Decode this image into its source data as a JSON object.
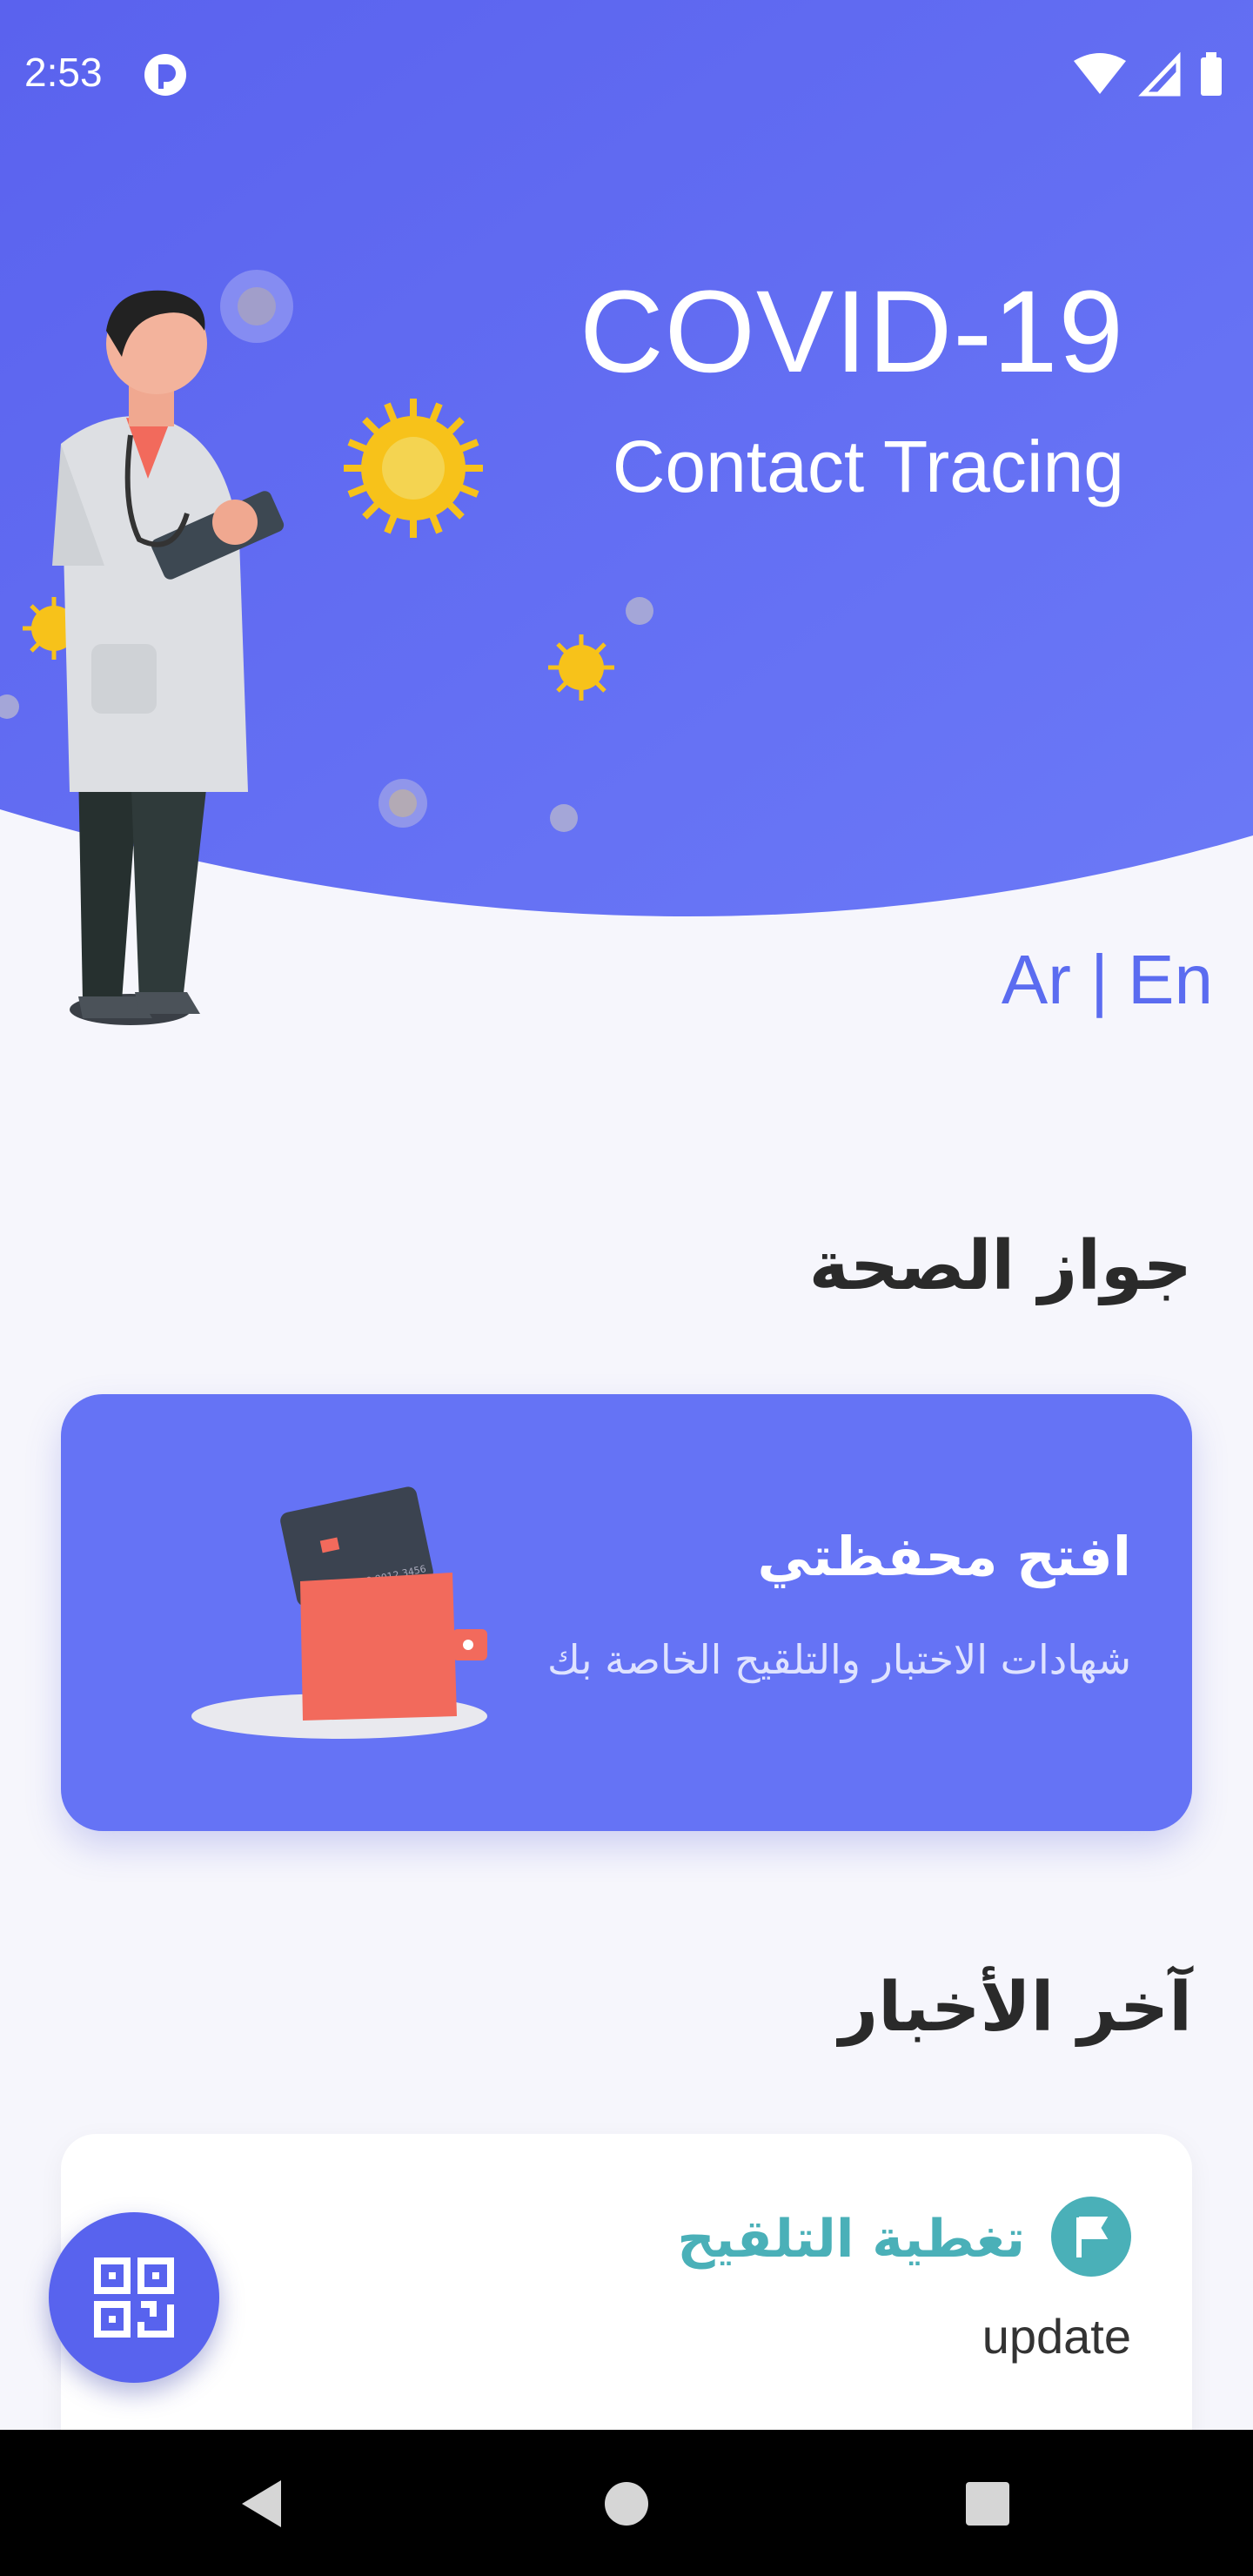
{
  "status_bar": {
    "time": "2:53"
  },
  "hero": {
    "title": "COVID-19",
    "subtitle": "Contact Tracing",
    "colors": {
      "gradient_start": "#5b63ef",
      "gradient_end": "#6a78f6"
    }
  },
  "language": {
    "ar": "Ar",
    "separator": "|",
    "en": "En"
  },
  "health_pass": {
    "section_title": "جواز الصحة",
    "wallet_card": {
      "title": "افتح محفظتي",
      "subtitle": "شهادات الاختبار والتلقيح الخاصة بك",
      "card_number": "1234 5678 9012 3456"
    }
  },
  "news": {
    "section_title": "آخر الأخبار",
    "items": [
      {
        "title": "تغطية التلقيح",
        "subtitle": "update",
        "icon": "flag-icon"
      }
    ]
  },
  "fab": {
    "icon": "qr-code-icon"
  },
  "nav": {
    "back": "back-icon",
    "home": "home-icon",
    "recents": "recents-icon"
  },
  "colors": {
    "accent": "#5b6cf0",
    "news_accent": "#4ab0b8",
    "background": "#f6f6fc"
  }
}
